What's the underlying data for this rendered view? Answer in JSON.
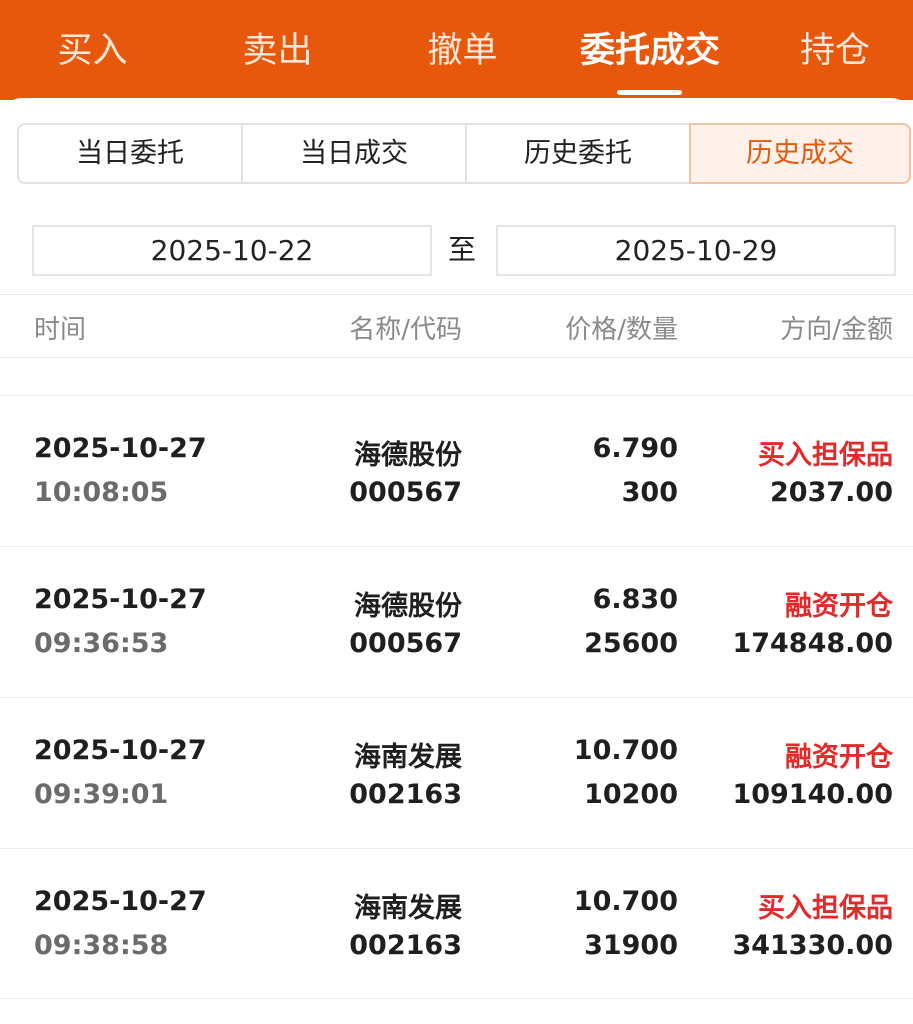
{
  "top_tabs": [
    {
      "label": "买入",
      "active": false
    },
    {
      "label": "卖出",
      "active": false
    },
    {
      "label": "撤单",
      "active": false
    },
    {
      "label": "委托成交",
      "active": true
    },
    {
      "label": "持仓",
      "active": false
    }
  ],
  "sub_tabs": [
    {
      "label": "当日委托",
      "active": false
    },
    {
      "label": "当日成交",
      "active": false
    },
    {
      "label": "历史委托",
      "active": false
    },
    {
      "label": "历史成交",
      "active": true
    }
  ],
  "date_range": {
    "start": "2025-10-22",
    "separator": "至",
    "end": "2025-10-29"
  },
  "table": {
    "headers": [
      "时间",
      "名称/代码",
      "价格/数量",
      "方向/金额"
    ],
    "rows": [
      {
        "date": "2025-10-27",
        "time": "10:08:05",
        "name": "海德股份",
        "code": "000567",
        "price": "6.790",
        "qty": "300",
        "direction": "买入担保品",
        "amount": "2037.00"
      },
      {
        "date": "2025-10-27",
        "time": "09:36:53",
        "name": "海德股份",
        "code": "000567",
        "price": "6.830",
        "qty": "25600",
        "direction": "融资开仓",
        "amount": "174848.00"
      },
      {
        "date": "2025-10-27",
        "time": "09:39:01",
        "name": "海南发展",
        "code": "002163",
        "price": "10.700",
        "qty": "10200",
        "direction": "融资开仓",
        "amount": "109140.00"
      },
      {
        "date": "2025-10-27",
        "time": "09:38:58",
        "name": "海南发展",
        "code": "002163",
        "price": "10.700",
        "qty": "31900",
        "direction": "买入担保品",
        "amount": "341330.00"
      }
    ]
  },
  "colors": {
    "brand": "#e8580c",
    "direction_text": "#e32a2a"
  }
}
